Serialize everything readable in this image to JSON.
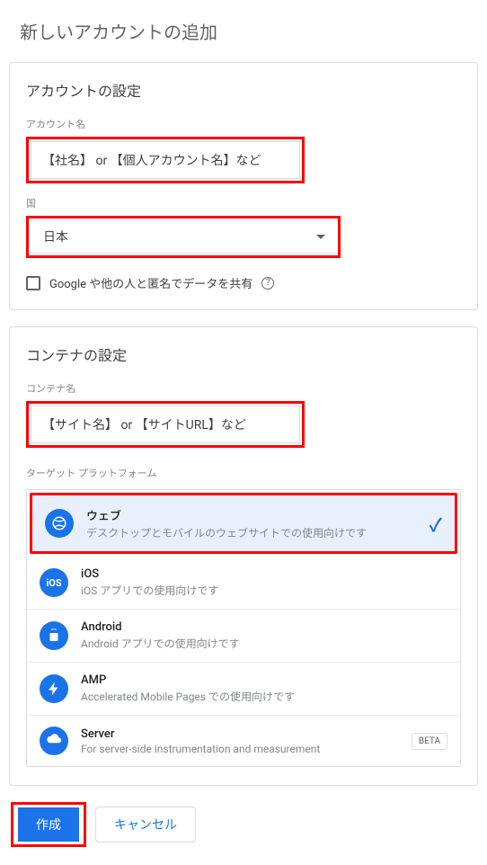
{
  "page_title": "新しいアカウントの追加",
  "account_section": {
    "title": "アカウントの設定",
    "name_label": "アカウント名",
    "name_value": "【社名】 or 【個人アカウント名】など",
    "country_label": "国",
    "country_value": "日本",
    "share_label": "Google や他の人と匿名でデータを共有"
  },
  "container_section": {
    "title": "コンテナの設定",
    "name_label": "コンテナ名",
    "name_value": "【サイト名】 or 【サイトURL】など",
    "platform_label": "ターゲット プラットフォーム",
    "platforms": [
      {
        "name": "ウェブ",
        "desc": "デスクトップとモバイルのウェブサイトでの使用向けです",
        "selected": true
      },
      {
        "name": "iOS",
        "desc": "iOS アプリでの使用向けです"
      },
      {
        "name": "Android",
        "desc": "Android アプリでの使用向けです"
      },
      {
        "name": "AMP",
        "desc": "Accelerated Mobile Pages での使用向けです"
      },
      {
        "name": "Server",
        "desc": "For server-side instrumentation and measurement",
        "badge": "BETA"
      }
    ]
  },
  "buttons": {
    "create": "作成",
    "cancel": "キャンセル"
  }
}
